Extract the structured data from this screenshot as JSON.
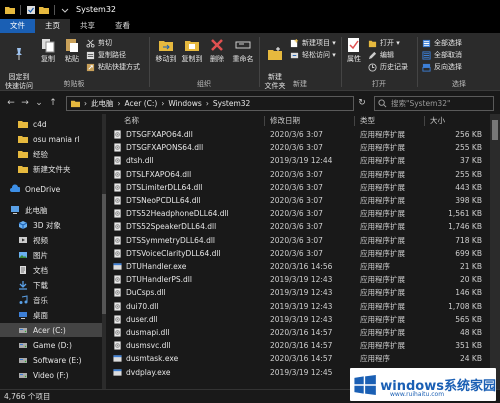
{
  "window": {
    "title": "System32"
  },
  "tabs": [
    {
      "label": "文件"
    },
    {
      "label": "主页"
    },
    {
      "label": "共享"
    },
    {
      "label": "查看"
    }
  ],
  "ribbon": {
    "clipboard": {
      "label": "剪贴板",
      "pin": "固定到\n快速访问",
      "copy": "复制",
      "paste": "粘贴",
      "cut": "剪切",
      "copy_path": "复制路径",
      "paste_shortcut": "粘贴快捷方式"
    },
    "organize": {
      "label": "组织",
      "move_to": "移动到",
      "copy_to": "复制到",
      "delete": "删除",
      "rename": "重命名"
    },
    "new": {
      "label": "新建",
      "new_folder": "新建\n文件夹",
      "new_item": "新建项目 ▾",
      "easy_access": "轻松访问 ▾"
    },
    "open": {
      "label": "打开",
      "properties": "属性",
      "open": "打开 ▾",
      "edit": "编辑",
      "history": "历史记录"
    },
    "select": {
      "label": "选择",
      "select_all": "全部选择",
      "select_none": "全部取消",
      "invert": "反向选择"
    }
  },
  "address": {
    "crumbs": [
      "此电脑",
      "Acer (C:)",
      "Windows",
      "System32"
    ],
    "search_placeholder": "搜索\"System32\""
  },
  "nav": [
    {
      "label": "c4d",
      "icon": "folder-icon",
      "indent": 1
    },
    {
      "label": "osu mania rl",
      "icon": "folder-icon",
      "indent": 1
    },
    {
      "label": "经验",
      "icon": "folder-icon",
      "indent": 1
    },
    {
      "label": "新建文件夹",
      "icon": "folder-icon",
      "indent": 1
    },
    {
      "label": "OneDrive",
      "icon": "cloud-icon",
      "indent": 0
    },
    {
      "label": "此电脑",
      "icon": "computer-icon",
      "indent": 0
    },
    {
      "label": "3D 对象",
      "icon": "cube-icon",
      "indent": 1
    },
    {
      "label": "视频",
      "icon": "video-icon",
      "indent": 1
    },
    {
      "label": "图片",
      "icon": "picture-icon",
      "indent": 1
    },
    {
      "label": "文档",
      "icon": "document-icon",
      "indent": 1
    },
    {
      "label": "下载",
      "icon": "download-icon",
      "indent": 1
    },
    {
      "label": "音乐",
      "icon": "music-icon",
      "indent": 1
    },
    {
      "label": "桌面",
      "icon": "desktop-icon",
      "indent": 1
    },
    {
      "label": "Acer (C:)",
      "icon": "drive-icon",
      "indent": 1,
      "selected": true
    },
    {
      "label": "Game (D:)",
      "icon": "drive-icon",
      "indent": 1
    },
    {
      "label": "Software (E:)",
      "icon": "drive-icon",
      "indent": 1
    },
    {
      "label": "Video (F:)",
      "icon": "drive-icon",
      "indent": 1
    }
  ],
  "columns": {
    "name": "名称",
    "date": "修改日期",
    "type": "类型",
    "size": "大小"
  },
  "files": [
    {
      "name": "DTSGFXAPO64.dll",
      "date": "2020/3/6 3:07",
      "type": "应用程序扩展",
      "size": "256 KB",
      "icon": "dll-icon"
    },
    {
      "name": "DTSGFXAPONS64.dll",
      "date": "2020/3/6 3:07",
      "type": "应用程序扩展",
      "size": "255 KB",
      "icon": "dll-icon"
    },
    {
      "name": "dtsh.dll",
      "date": "2019/3/19 12:44",
      "type": "应用程序扩展",
      "size": "37 KB",
      "icon": "dll-icon"
    },
    {
      "name": "DTSLFXAPO64.dll",
      "date": "2020/3/6 3:07",
      "type": "应用程序扩展",
      "size": "255 KB",
      "icon": "dll-icon"
    },
    {
      "name": "DTSLimiterDLL64.dll",
      "date": "2020/3/6 3:07",
      "type": "应用程序扩展",
      "size": "443 KB",
      "icon": "dll-icon"
    },
    {
      "name": "DTSNeoPCDLL64.dll",
      "date": "2020/3/6 3:07",
      "type": "应用程序扩展",
      "size": "398 KB",
      "icon": "dll-icon"
    },
    {
      "name": "DTS52HeadphoneDLL64.dll",
      "date": "2020/3/6 3:07",
      "type": "应用程序扩展",
      "size": "1,561 KB",
      "icon": "dll-icon"
    },
    {
      "name": "DTS52SpeakerDLL64.dll",
      "date": "2020/3/6 3:07",
      "type": "应用程序扩展",
      "size": "1,746 KB",
      "icon": "dll-icon"
    },
    {
      "name": "DTSSymmetryDLL64.dll",
      "date": "2020/3/6 3:07",
      "type": "应用程序扩展",
      "size": "718 KB",
      "icon": "dll-icon"
    },
    {
      "name": "DTSVoiceClarityDLL64.dll",
      "date": "2020/3/6 3:07",
      "type": "应用程序扩展",
      "size": "699 KB",
      "icon": "dll-icon"
    },
    {
      "name": "DTUHandler.exe",
      "date": "2020/3/16 14:56",
      "type": "应用程序",
      "size": "21 KB",
      "icon": "exe-icon"
    },
    {
      "name": "DTUHandlerPS.dll",
      "date": "2019/3/19 12:43",
      "type": "应用程序扩展",
      "size": "20 KB",
      "icon": "dll-icon"
    },
    {
      "name": "DuCsps.dll",
      "date": "2019/3/19 12:43",
      "type": "应用程序扩展",
      "size": "146 KB",
      "icon": "dll-icon"
    },
    {
      "name": "dui70.dll",
      "date": "2019/3/19 12:43",
      "type": "应用程序扩展",
      "size": "1,708 KB",
      "icon": "dll-icon"
    },
    {
      "name": "duser.dll",
      "date": "2019/3/19 12:43",
      "type": "应用程序扩展",
      "size": "565 KB",
      "icon": "dll-icon"
    },
    {
      "name": "dusmapi.dll",
      "date": "2020/3/16 14:57",
      "type": "应用程序扩展",
      "size": "48 KB",
      "icon": "dll-icon"
    },
    {
      "name": "dusmsvc.dll",
      "date": "2020/3/16 14:57",
      "type": "应用程序扩展",
      "size": "351 KB",
      "icon": "dll-icon"
    },
    {
      "name": "dusmtask.exe",
      "date": "2020/3/16 14:57",
      "type": "应用程序",
      "size": "24 KB",
      "icon": "exe-icon"
    },
    {
      "name": "dvdplay.exe",
      "date": "2019/3/19 12:45",
      "type": "应用程序",
      "size": "",
      "icon": "exe-icon"
    }
  ],
  "status": {
    "count": "4,766 个项目"
  },
  "watermark": {
    "brand": "windows系统家园",
    "url": "www.ruihaitu.com"
  },
  "colors": {
    "accent": "#1a5fb4",
    "folder": "#e6b93e",
    "background": "#191919",
    "ribbon": "#2b2b2b"
  }
}
